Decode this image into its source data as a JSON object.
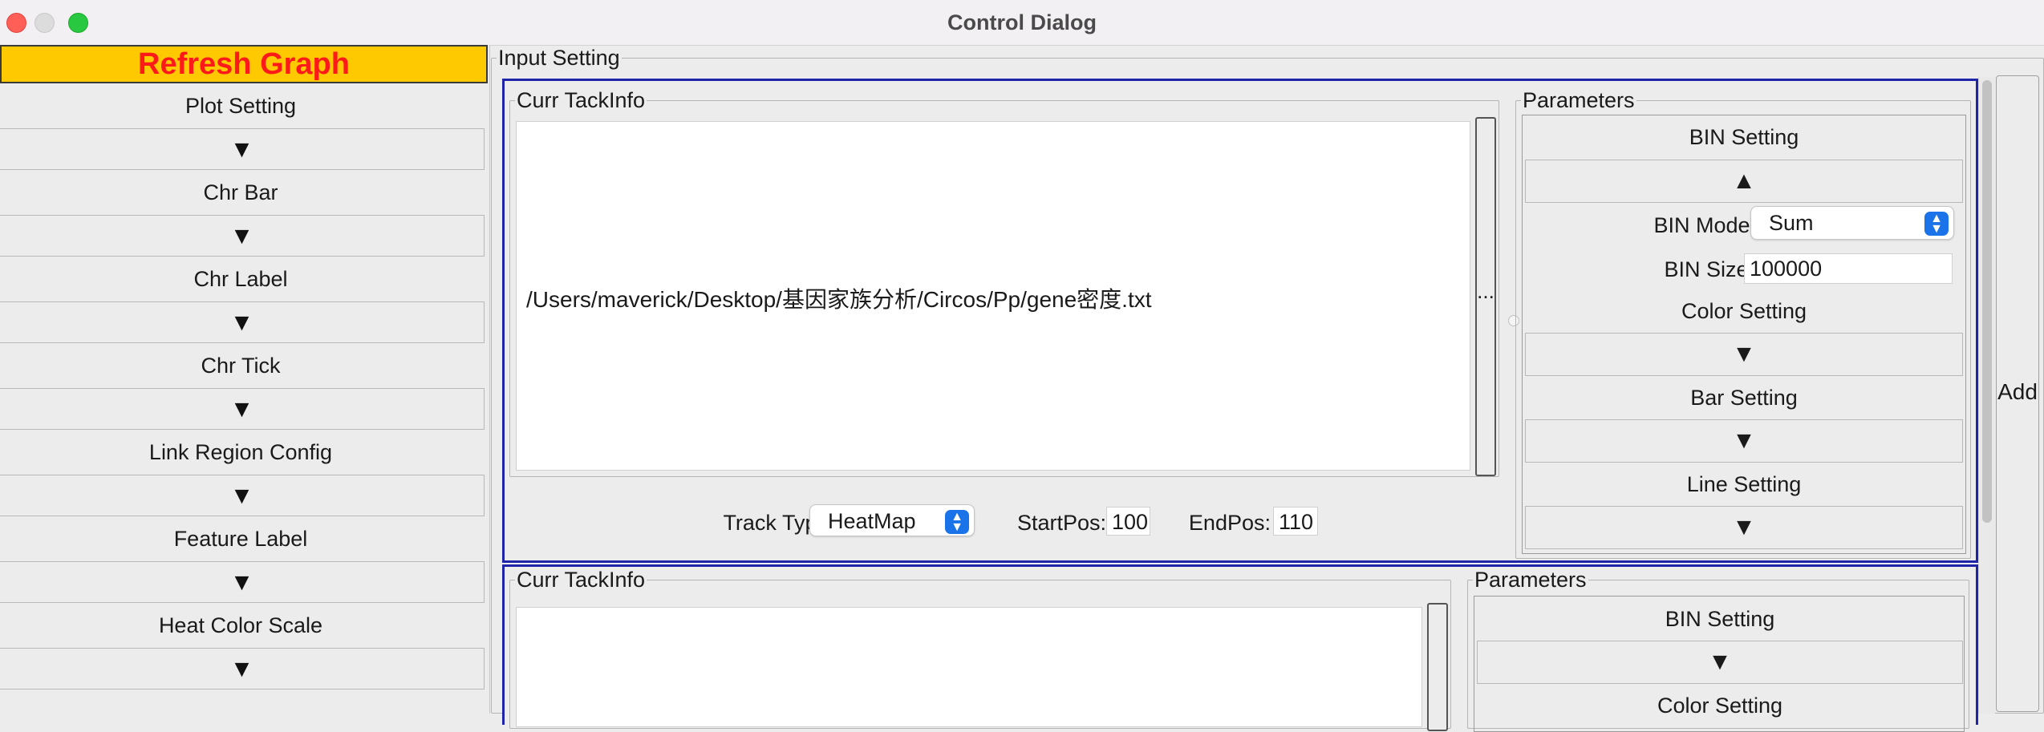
{
  "window": {
    "title": "Control Dialog"
  },
  "left_panel": {
    "refresh_label": "Refresh Graph",
    "sections": [
      {
        "label": "Plot Setting",
        "arrow": "▼"
      },
      {
        "label": "Chr Bar",
        "arrow": "▼"
      },
      {
        "label": "Chr Label",
        "arrow": "▼"
      },
      {
        "label": "Chr Tick",
        "arrow": "▼"
      },
      {
        "label": "Link Region Config",
        "arrow": "▼"
      },
      {
        "label": "Feature Label",
        "arrow": "▼"
      },
      {
        "label": "Heat Color Scale",
        "arrow": "▼"
      }
    ]
  },
  "input_setting": {
    "title": "Input Setting",
    "add_label": "Add",
    "tracks": [
      {
        "info_title": "Curr TackInfo",
        "file_path": "/Users/maverick/Desktop/基因家族分析/Circos/Pp/gene密度.txt",
        "browse_label": "...",
        "track_type_label": "Track Type:",
        "track_type_value": "HeatMap",
        "start_label": "StartPos:",
        "start_value": "100",
        "end_label": "EndPos:",
        "end_value": "110",
        "params": {
          "title": "Parameters",
          "bin_setting": "BIN Setting",
          "bin_arrow": "▲",
          "bin_mode_label": "BIN Mode:",
          "bin_mode_value": "Sum",
          "bin_size_label": "BIN Size:",
          "bin_size_value": "100000",
          "color_setting": "Color Setting",
          "color_arrow": "▼",
          "bar_setting": "Bar Setting",
          "bar_arrow": "▼",
          "line_setting": "Line Setting",
          "line_arrow": "▼"
        }
      },
      {
        "info_title": "Curr TackInfo",
        "params": {
          "title": "Parameters",
          "bin_setting": "BIN Setting",
          "bin_arrow": "▼",
          "color_setting": "Color Setting"
        }
      }
    ]
  }
}
